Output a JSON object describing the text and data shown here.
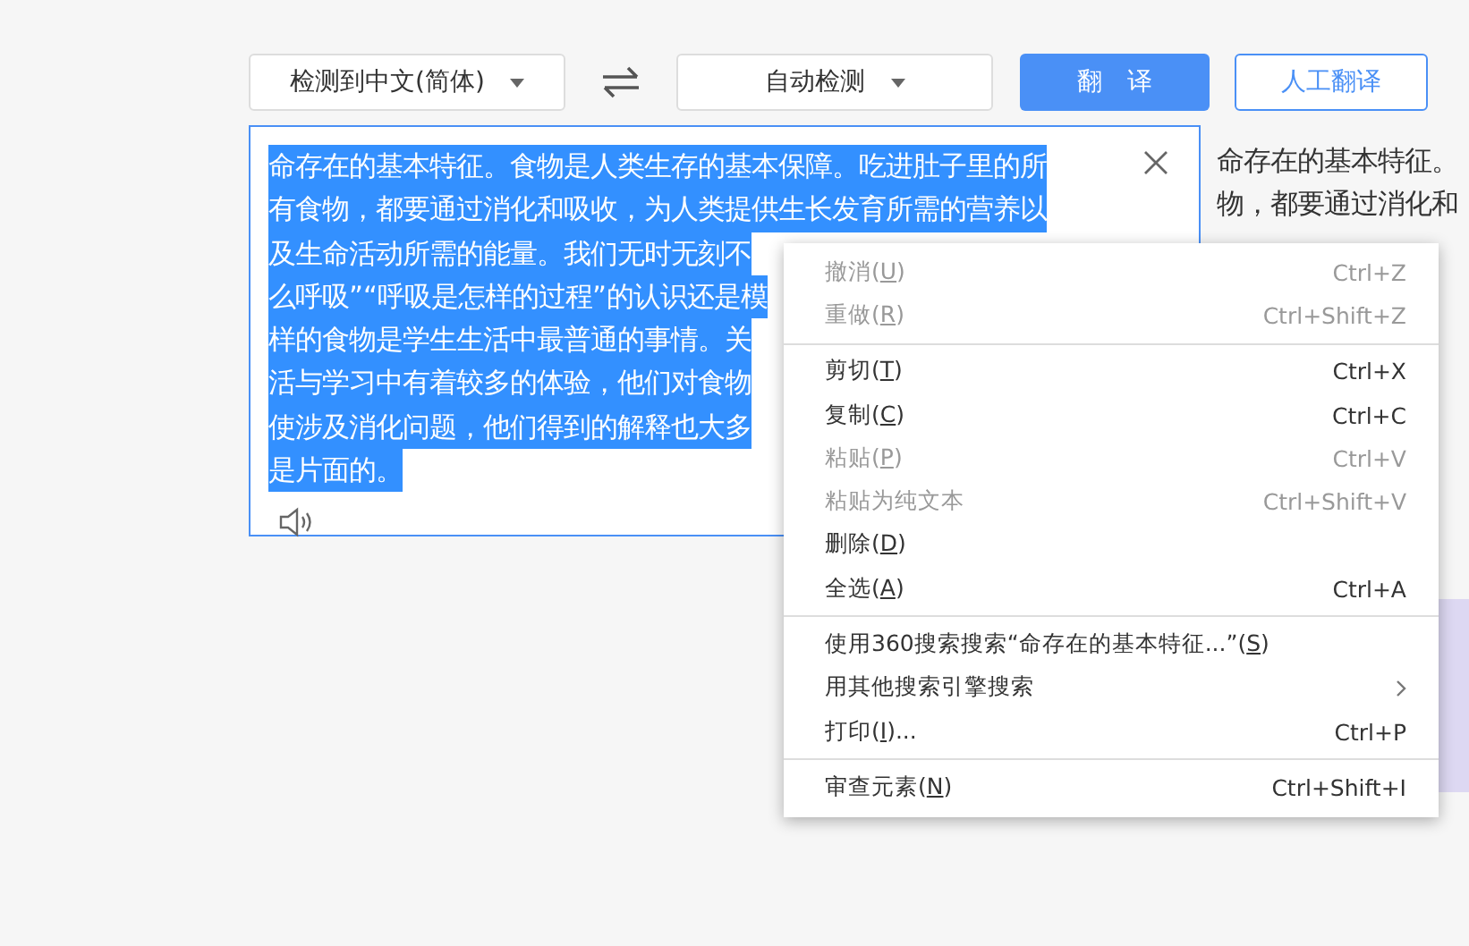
{
  "toolbar": {
    "source_language": "检测到中文(简体)",
    "target_language": "自动检测",
    "translate_button": "翻　译",
    "human_translate_button": "人工翻译"
  },
  "source": {
    "lines": [
      {
        "text": "命存在的基本特征。食物是人类生存的基本保障。吃进肚子里的所",
        "selected": true
      },
      {
        "text": "有食物，都要通过消化和吸收，为人类提供生长发育所需的营养以",
        "selected": true
      },
      {
        "text": "及生命活动所需的能量。我们无时无刻不",
        "selected": true
      },
      {
        "text": "么呼吸”“呼吸是怎样的过程”的认识还是模",
        "selected": true
      },
      {
        "text": "样的食物是学生生活中最普通的事情。关",
        "selected": true
      },
      {
        "text": "活与学习中有着较多的体验，他们对食物",
        "selected": true
      },
      {
        "text": "使涉及消化问题，他们得到的解释也大多",
        "selected": true
      },
      {
        "text": "是片面的。",
        "selected": true
      }
    ]
  },
  "result": {
    "lines": [
      "命存在的基本特征。",
      "物，都要通过消化和"
    ]
  },
  "context_menu": [
    {
      "kind": "item",
      "label": [
        "撤消(",
        "U",
        ")"
      ],
      "shortcut": "Ctrl+Z",
      "disabled": true
    },
    {
      "kind": "item",
      "label": [
        "重做(",
        "R",
        ")"
      ],
      "shortcut": "Ctrl+Shift+Z",
      "disabled": true
    },
    {
      "kind": "separator"
    },
    {
      "kind": "item",
      "label": [
        "剪切(",
        "T",
        ")"
      ],
      "shortcut": "Ctrl+X",
      "disabled": false
    },
    {
      "kind": "item",
      "label": [
        "复制(",
        "C",
        ")"
      ],
      "shortcut": "Ctrl+C",
      "disabled": false
    },
    {
      "kind": "item",
      "label": [
        "粘贴(",
        "P",
        ")"
      ],
      "shortcut": "Ctrl+V",
      "disabled": true
    },
    {
      "kind": "item",
      "label": [
        "粘贴为纯文本"
      ],
      "shortcut": "Ctrl+Shift+V",
      "disabled": true
    },
    {
      "kind": "item",
      "label": [
        "删除(",
        "D",
        ")"
      ],
      "disabled": false
    },
    {
      "kind": "item",
      "label": [
        "全选(",
        "A",
        ")"
      ],
      "shortcut": "Ctrl+A",
      "disabled": false
    },
    {
      "kind": "separator"
    },
    {
      "kind": "item",
      "label": [
        "使用360搜索搜索“命存在的基本特征...”(",
        "S",
        ")"
      ],
      "disabled": false
    },
    {
      "kind": "submenu",
      "label": [
        "用其他搜索引擎搜索"
      ],
      "disabled": false
    },
    {
      "kind": "item",
      "label": [
        "打印(",
        "I",
        ")..."
      ],
      "shortcut": "Ctrl+P",
      "disabled": false
    },
    {
      "kind": "separator"
    },
    {
      "kind": "item",
      "label": [
        "审查元素(",
        "N",
        ")"
      ],
      "shortcut": "Ctrl+Shift+I",
      "disabled": false
    }
  ]
}
